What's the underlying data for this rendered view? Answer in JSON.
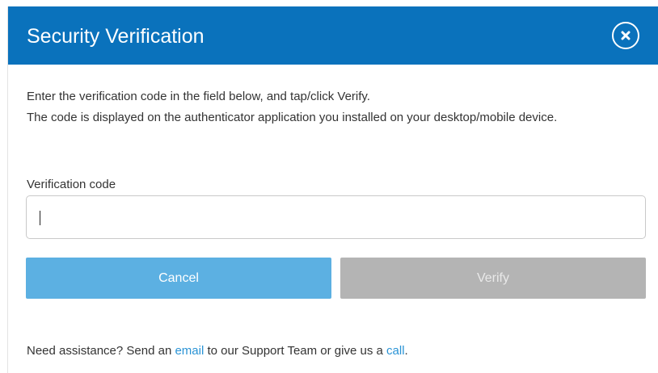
{
  "dialog": {
    "title": "Security Verification",
    "close_icon": "close-icon",
    "colors": {
      "header": "#0a72bc",
      "cancel_button": "#5cb0e2",
      "verify_button_disabled": "#b4b4b4",
      "link": "#2a93d5"
    }
  },
  "instructions": {
    "line1": "Enter the verification code in the field below, and tap/click Verify.",
    "line2": "The code is displayed on the authenticator application you installed on your desktop/mobile device."
  },
  "form": {
    "code_label": "Verification code",
    "code_value": "",
    "cancel_label": "Cancel",
    "verify_label": "Verify"
  },
  "assistance": {
    "text_before": "Need assistance? Send an ",
    "email_link": "email",
    "text_middle": " to our Support Team or give us a ",
    "call_link": "call",
    "text_after": "."
  }
}
